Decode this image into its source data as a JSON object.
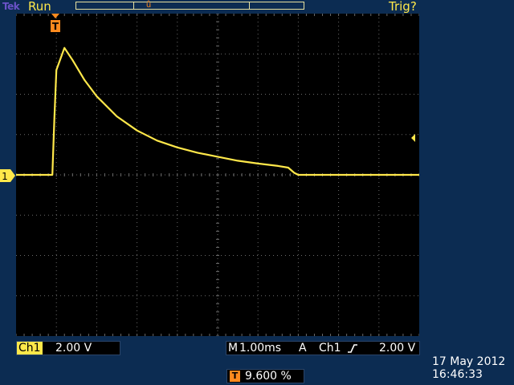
{
  "top": {
    "brand": "Tek",
    "acquisition_state": "Run",
    "trigger_status": "Trig?"
  },
  "colors": {
    "trace": "#ffe84a",
    "trigger_marker": "#ff8a1e",
    "grid": "#6a6a6a",
    "background": "#0c2c52"
  },
  "screen": {
    "divisions_x": 10,
    "divisions_y": 8,
    "trigger_marker_label": "T",
    "channel_marker_label": "1"
  },
  "channel": {
    "tag": "Ch1",
    "scale": "2.00 V"
  },
  "horizontal": {
    "prefix": "M",
    "timebase": "1.00ms",
    "trigger_mode": "A",
    "trigger_source": "Ch1",
    "slope_icon": "rising-edge-icon",
    "trigger_level": "2.00 V"
  },
  "trigger_position": {
    "badge": "T",
    "value": "9.600 %"
  },
  "datetime": {
    "date": "17 May 2012",
    "time": "16:46:33"
  },
  "chart_data": {
    "type": "line",
    "xlabel": "",
    "ylabel": "",
    "xlim": [
      0,
      10
    ],
    "ylim": [
      -4,
      4
    ],
    "grid": true,
    "series": [
      {
        "x": [
          0,
          0.9,
          0.95,
          1.0,
          1.2,
          1.4,
          1.7,
          2.0,
          2.5,
          3.0,
          3.5,
          4.0,
          4.5,
          5.0,
          5.5,
          6.0,
          6.5,
          6.75,
          6.9,
          7.0,
          8.0,
          9.0,
          10.0
        ],
        "y": [
          0,
          0,
          1.4,
          2.6,
          3.15,
          2.85,
          2.35,
          1.95,
          1.45,
          1.1,
          0.85,
          0.68,
          0.55,
          0.45,
          0.35,
          0.28,
          0.22,
          0.18,
          0.05,
          0.0,
          0.0,
          0.0,
          0.0
        ]
      }
    ]
  }
}
